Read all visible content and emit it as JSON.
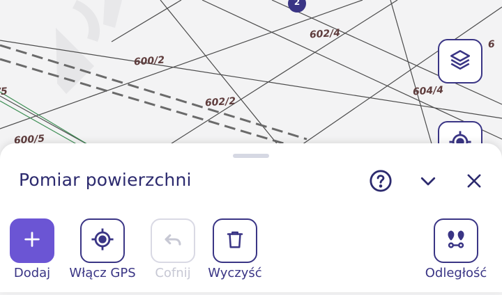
{
  "map": {
    "parcels": [
      "600/2",
      "602/2",
      "602/4",
      "604/4",
      "600/5",
      "/5"
    ],
    "marker_badge": "2"
  },
  "map_controls": {
    "layers_icon": "layers-icon",
    "locate_icon": "crosshair-icon"
  },
  "panel": {
    "title": "Pomiar powierzchni",
    "help_icon": "help-circle-icon",
    "collapse_icon": "chevron-down-icon",
    "close_icon": "close-icon"
  },
  "toolbar": {
    "add_label": "Dodaj",
    "gps_label": "Włącz GPS",
    "undo_label": "Cofnij",
    "clear_label": "Wyczyść",
    "distance_label": "Odległość"
  },
  "colors": {
    "accent": "#6b55d4",
    "primary_text": "#2c2a6e",
    "disabled": "#c7c8d4",
    "parcel_label": "#5e3c3c"
  }
}
